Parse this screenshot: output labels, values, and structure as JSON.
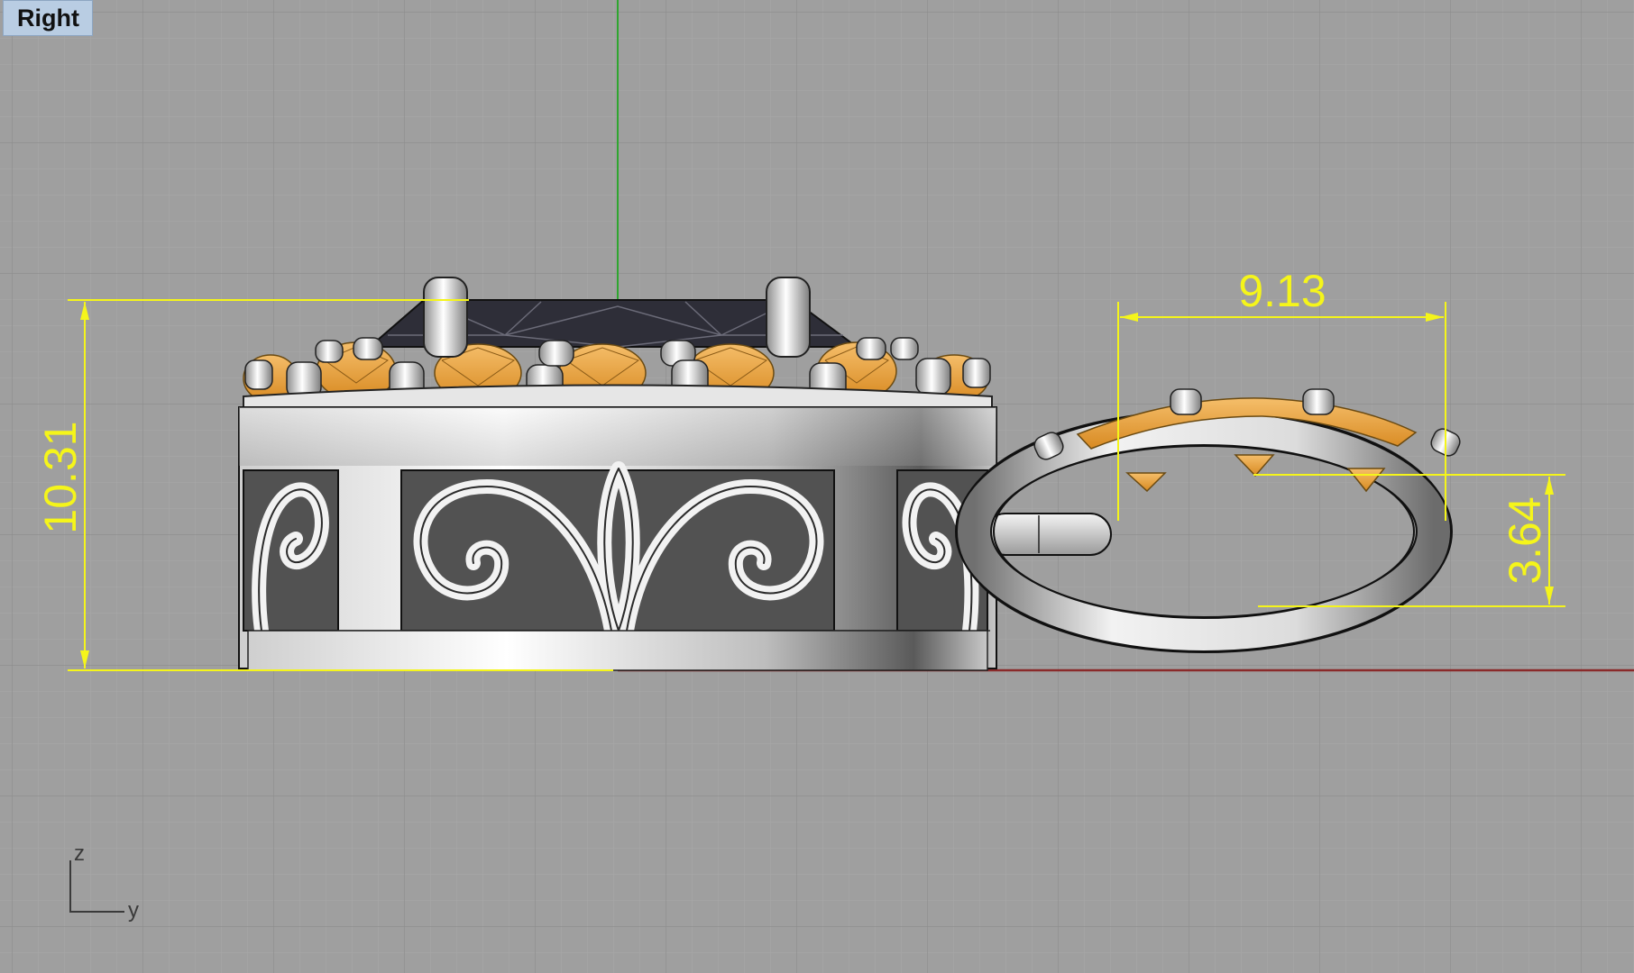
{
  "viewport": {
    "title": "Right",
    "background_color": "#9f9f9f",
    "grid_minor_color": "#a9a9a9",
    "grid_major_color": "#8b8b8b"
  },
  "dimensions": [
    {
      "name": "overall-height",
      "value": "10.31"
    },
    {
      "name": "bail-width",
      "value": "9.13"
    },
    {
      "name": "bail-height",
      "value": "3.64"
    }
  ],
  "axis_icon": {
    "vertical_label": "z",
    "horizontal_label": "y"
  },
  "colors": {
    "dimension": "#f5f51a",
    "metal": "#d9d9d9",
    "accent_stone": "#f0a845",
    "center_stone": "#2e2e38",
    "y_axis_line": "#2fa62f",
    "x_axis_line": "#8a2a2a"
  }
}
